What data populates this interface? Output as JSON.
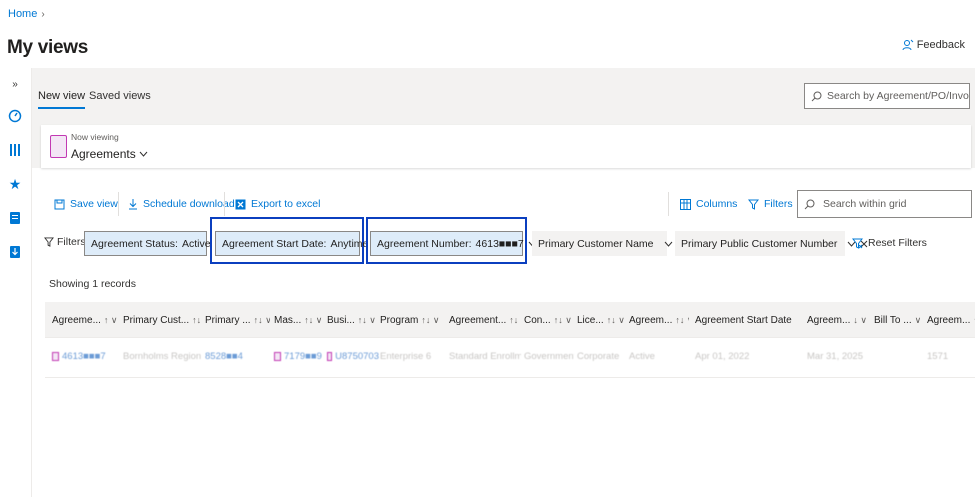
{
  "breadcrumb": {
    "home": "Home",
    "separator": "›"
  },
  "page": {
    "title": "My views",
    "feedback": "Feedback"
  },
  "tabs": [
    {
      "label": "New view",
      "active": true
    },
    {
      "label": "Saved views",
      "active": false
    }
  ],
  "global_search": {
    "placeholder": "Search by Agreement/PO/Invoice no., ..."
  },
  "viewing": {
    "label": "Now viewing",
    "value": "Agreements"
  },
  "toolbar": {
    "save_view": "Save view",
    "schedule_download": "Schedule download",
    "export_to_excel": "Export to excel",
    "columns": "Columns",
    "filters": "Filters",
    "grid_search_placeholder": "Search within grid"
  },
  "filters": {
    "label": "Filters :",
    "items": [
      {
        "name": "Agreement Status:",
        "value": "Active",
        "style": "blue",
        "removable": false
      },
      {
        "name": "Agreement Start Date:",
        "value": "Anytime",
        "style": "blue",
        "removable": false,
        "highlighted": true
      },
      {
        "name": "Agreement Number:",
        "value": "4613■■■7",
        "style": "blue",
        "removable": true,
        "highlighted": true
      },
      {
        "name": "Primary Customer Name",
        "value": "",
        "style": "gray",
        "removable": true
      },
      {
        "name": "Primary Public Customer Number",
        "value": "",
        "style": "gray",
        "removable": true
      }
    ],
    "reset": "Reset Filters"
  },
  "records": {
    "showing": "Showing 1 records"
  },
  "grid": {
    "columns": [
      {
        "label": "Agreeme...",
        "sort": "↑ ∨"
      },
      {
        "label": "Primary Cust...",
        "sort": "↑↓ ∨"
      },
      {
        "label": "Primary ...",
        "sort": "↑↓ ∨"
      },
      {
        "label": "Mas...",
        "sort": "↑↓ ∨"
      },
      {
        "label": "Busi...",
        "sort": "↑↓ ∨"
      },
      {
        "label": "Program",
        "sort": "↑↓ ∨"
      },
      {
        "label": "Agreement...",
        "sort": "↑↓ ∨"
      },
      {
        "label": "Con...",
        "sort": "↑↓ ∨"
      },
      {
        "label": "Lice...",
        "sort": "↑↓ ∨"
      },
      {
        "label": "Agreem...",
        "sort": "↑↓ ∨"
      },
      {
        "label": "Agreement Start Date",
        "sort": "↑↓ ∨"
      },
      {
        "label": "Agreem...",
        "sort": "↓ ∨"
      },
      {
        "label": "Bill To ...",
        "sort": "∨"
      },
      {
        "label": "Agreem...",
        "sort": "↑↓"
      }
    ],
    "rows": [
      [
        "4613■■■7",
        "Bornholms Regionsk...",
        "8528■■4",
        "7179■■9",
        "U8750703",
        "Enterprise 6",
        "Standard Enrollment",
        "Government",
        "Corporate",
        "Active",
        "",
        "Apr 01, 2022",
        "Mar 31, 2025",
        "",
        "1571"
      ]
    ]
  },
  "colors": {
    "accent": "#0078d4",
    "highlight_border": "#0b3fbf",
    "pill_blue": "#deecf9",
    "doc_icon": "#c239b3"
  }
}
